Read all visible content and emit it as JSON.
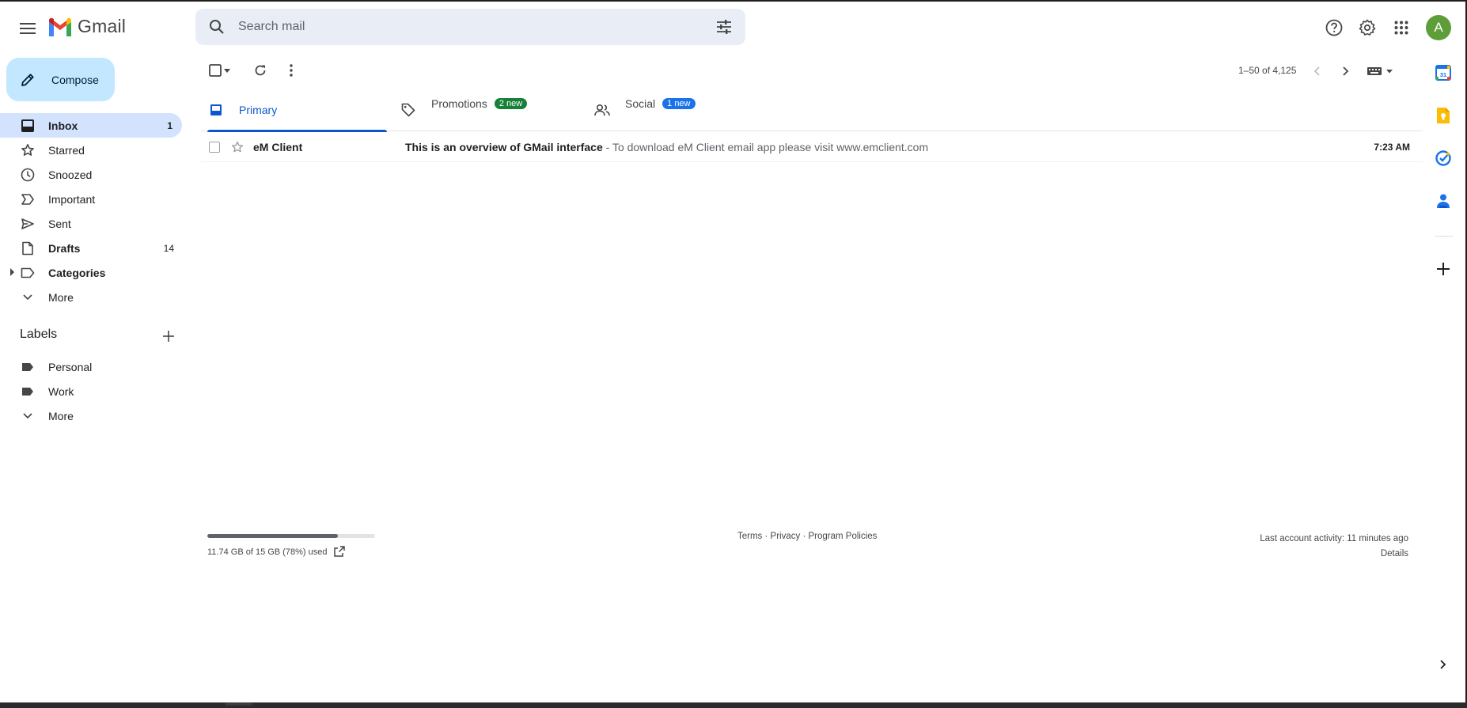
{
  "app": {
    "name": "Gmail"
  },
  "search": {
    "placeholder": "Search mail"
  },
  "header": {
    "icons": [
      "menu-icon",
      "search-icon",
      "tune-icon",
      "help-icon",
      "gear-icon",
      "apps-grid-icon"
    ],
    "avatar_letter": "A",
    "avatar_color": "#5e9e3a"
  },
  "sidebar": {
    "compose_label": "Compose",
    "items": [
      {
        "label": "Inbox",
        "count": "1",
        "icon": "inbox-icon"
      },
      {
        "label": "Starred",
        "count": "",
        "icon": "star-icon"
      },
      {
        "label": "Snoozed",
        "count": "",
        "icon": "clock-icon"
      },
      {
        "label": "Important",
        "count": "",
        "icon": "important-icon"
      },
      {
        "label": "Sent",
        "count": "",
        "icon": "send-icon"
      },
      {
        "label": "Drafts",
        "count": "14",
        "icon": "draft-icon"
      },
      {
        "label": "Categories",
        "count": "",
        "icon": "label-outline-icon"
      },
      {
        "label": "More",
        "count": "",
        "icon": "chevron-down-icon"
      }
    ],
    "labels_title": "Labels",
    "labels": [
      {
        "label": "Personal"
      },
      {
        "label": "Work"
      },
      {
        "label": "More"
      }
    ]
  },
  "toolbar": {
    "pagination": "1–50 of 4,125"
  },
  "tabs": [
    {
      "label": "Primary",
      "badge": ""
    },
    {
      "label": "Promotions",
      "badge": "2 new",
      "badge_color": "#188038"
    },
    {
      "label": "Social",
      "badge": "1 new",
      "badge_color": "#1a73e8"
    }
  ],
  "emails": [
    {
      "sender": "eM Client",
      "subject": "This is an overview of GMail interface",
      "snippet": " - To download eM Client email app please visit www.emclient.com",
      "time": "7:23 AM"
    }
  ],
  "footer": {
    "storage_text": "11.74 GB of 15 GB (78%) used",
    "storage_fraction": 0.78,
    "terms": "Terms",
    "privacy": "Privacy",
    "policies": "Program Policies",
    "separator": " · ",
    "activity": "Last account activity: 11 minutes ago",
    "details": "Details"
  },
  "side_panel": {
    "icons": [
      "calendar-icon",
      "keep-icon",
      "tasks-icon",
      "contacts-icon",
      "plus-icon",
      "chevron-right-icon"
    ],
    "calendar_day": "31"
  },
  "colors": {
    "accent": "#0b57d0",
    "compose_bg": "#c2e7ff",
    "active_nav": "#d3e3fd",
    "search_bg": "#e9eef6"
  }
}
